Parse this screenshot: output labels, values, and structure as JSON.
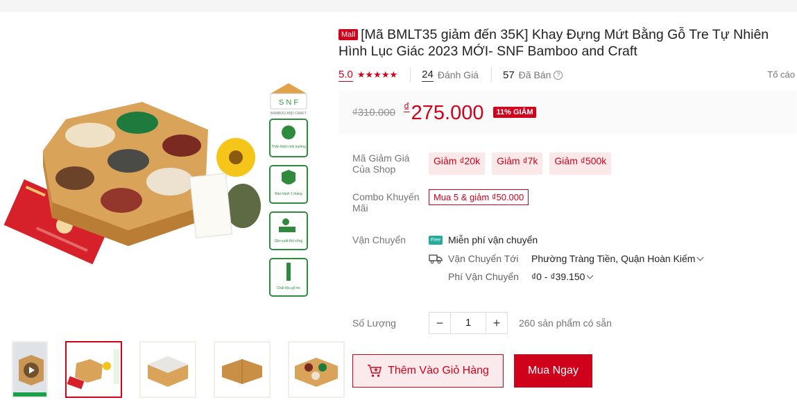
{
  "product": {
    "mall_badge": "Mall",
    "title": "[Mã BMLT35 giảm đến 35K] Khay Đựng Mứt Bằng Gỗ Tre Tự Nhiên Hình Lục Giác 2023 MỚI- SNF Bamboo and Craft",
    "rating": "5.0",
    "stars": 5,
    "review_count": "24",
    "review_label": "Đánh Giá",
    "sold_count": "57",
    "sold_label": "Đã Bán",
    "report_label": "Tố cáo",
    "old_price": "₫310.000",
    "currency": "₫",
    "price": "275.000",
    "discount": "11% GIẢM"
  },
  "gallery": {
    "brand_text": "S N F",
    "brand_sub": "BAMBOO AND CRAFT",
    "badges": [
      "Thân thiện môi trường",
      "Bảo hành 1 tháng",
      "Sản xuất thủ công",
      "Chất liệu gỗ tre"
    ]
  },
  "vouchers": {
    "label": "Mã Giảm Giá Của Shop",
    "items": [
      "Giảm ₫20k",
      "Giảm ₫7k",
      "Giảm ₫500k"
    ]
  },
  "combo": {
    "label": "Combo Khuyến Mãi",
    "value": "Mua 5 & giảm ₫50.000"
  },
  "shipping": {
    "label": "Vận Chuyển",
    "free_badge": "Free",
    "free_text": "Miễn phí vận chuyển",
    "to_label": "Vận Chuyển Tới",
    "to_value": "Phường Tràng Tiền, Quận Hoàn Kiếm",
    "fee_label": "Phí Vận Chuyển",
    "fee_value": "₫0 - ₫39.150"
  },
  "quantity": {
    "label": "Số Lượng",
    "minus": "−",
    "value": "1",
    "plus": "+",
    "stock": "260 sản phẩm có sẵn"
  },
  "actions": {
    "add_to_cart": "Thêm Vào Giỏ Hàng",
    "buy_now": "Mua Ngay"
  },
  "colors": {
    "accent": "#d0011b",
    "accent_light": "#fbeaeb"
  }
}
